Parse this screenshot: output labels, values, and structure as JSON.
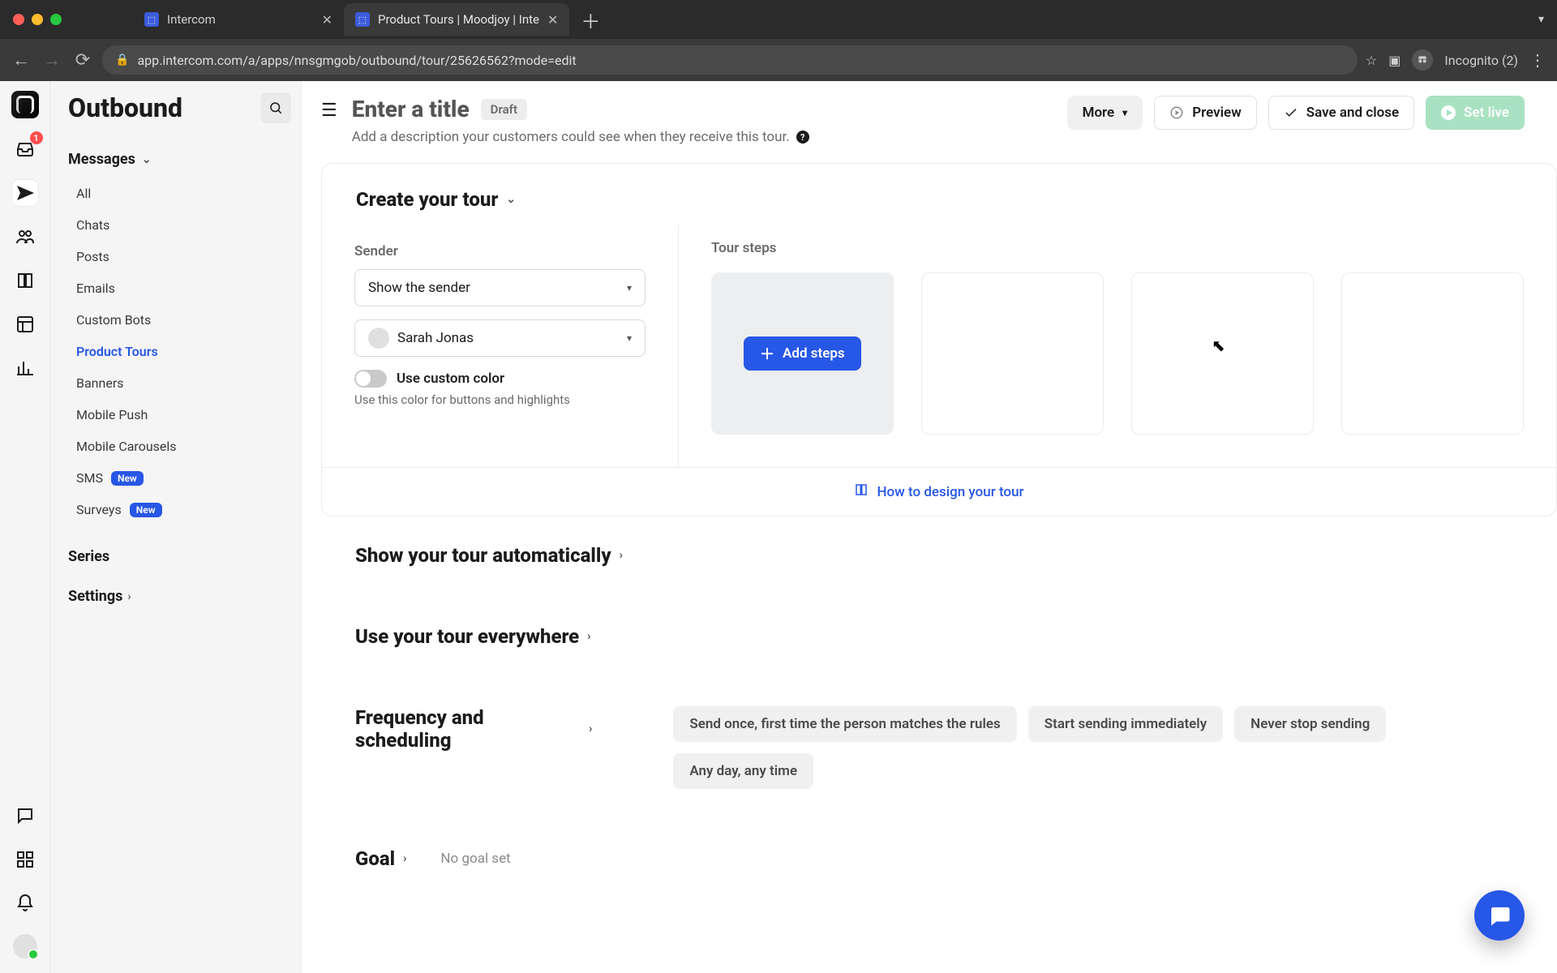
{
  "browser": {
    "tabs": [
      {
        "title": "Intercom"
      },
      {
        "title": "Product Tours | Moodjoy | Inte"
      }
    ],
    "url": "app.intercom.com/a/apps/nnsgmgob/outbound/tour/25626562?mode=edit",
    "incognito_label": "Incognito (2)"
  },
  "rail": {
    "inbox_badge": "1"
  },
  "sidebar": {
    "title": "Outbound",
    "messages": {
      "label": "Messages",
      "items": [
        "All",
        "Chats",
        "Posts",
        "Emails",
        "Custom Bots",
        "Product Tours",
        "Banners",
        "Mobile Push",
        "Mobile Carousels",
        "SMS",
        "Surveys"
      ],
      "new_badge": "New",
      "active_index": 5
    },
    "series": "Series",
    "settings": "Settings"
  },
  "header": {
    "title_placeholder": "Enter a title",
    "draft_badge": "Draft",
    "description": "Add a description your customers could see when they receive this tour.",
    "more": "More",
    "preview": "Preview",
    "save_close": "Save and close",
    "set_live": "Set live"
  },
  "create_tour": {
    "heading": "Create your tour",
    "sender_label": "Sender",
    "sender_mode": "Show the sender",
    "sender_name": "Sarah Jonas",
    "custom_color_label": "Use custom color",
    "custom_color_hint": "Use this color for buttons and highlights",
    "tour_steps_label": "Tour steps",
    "add_steps": "Add steps",
    "how_to": "How to design your tour"
  },
  "sections": {
    "show_auto": "Show your tour automatically",
    "everywhere": "Use your tour everywhere",
    "freq_heading": "Frequency and scheduling",
    "freq_chips": [
      "Send once, first time the person matches the rules",
      "Start sending immediately",
      "Never stop sending",
      "Any day, any time"
    ],
    "goal_heading": "Goal",
    "no_goal": "No goal set"
  }
}
